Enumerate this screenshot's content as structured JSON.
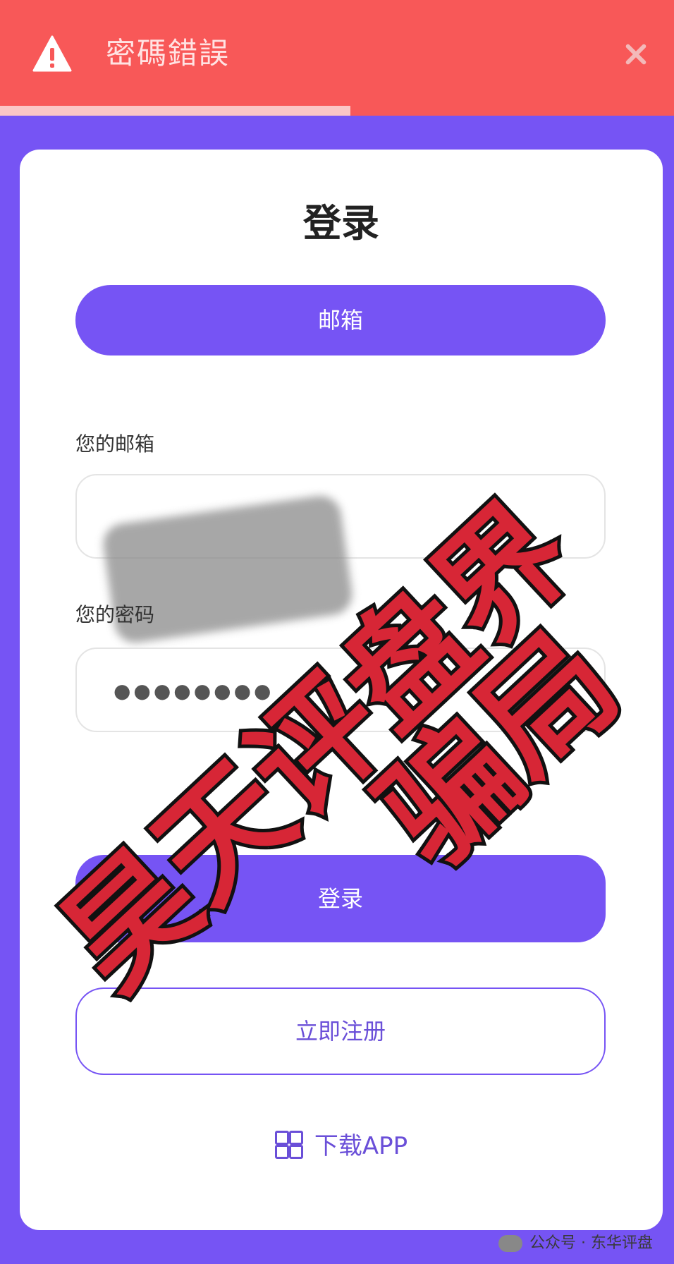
{
  "toast": {
    "message": "密碼錯誤",
    "icon": "warning-triangle-icon",
    "close_icon": "close-icon",
    "progress": 0.52,
    "color": "#f85858"
  },
  "card": {
    "title": "登录",
    "tab_label": "邮箱",
    "email_label": "您的邮箱",
    "password_label": "您的密码",
    "password_mask": "●●●●●●●●",
    "login_button": "登录",
    "register_button": "立即注册",
    "download_label": "下载APP"
  },
  "overlay": {
    "line1": "昊天评盘界",
    "line2": "骗局"
  },
  "watermark": "公众号 · 东华评盘",
  "colors": {
    "accent": "#7654f4",
    "error": "#f85858",
    "stamp": "#d72636"
  }
}
